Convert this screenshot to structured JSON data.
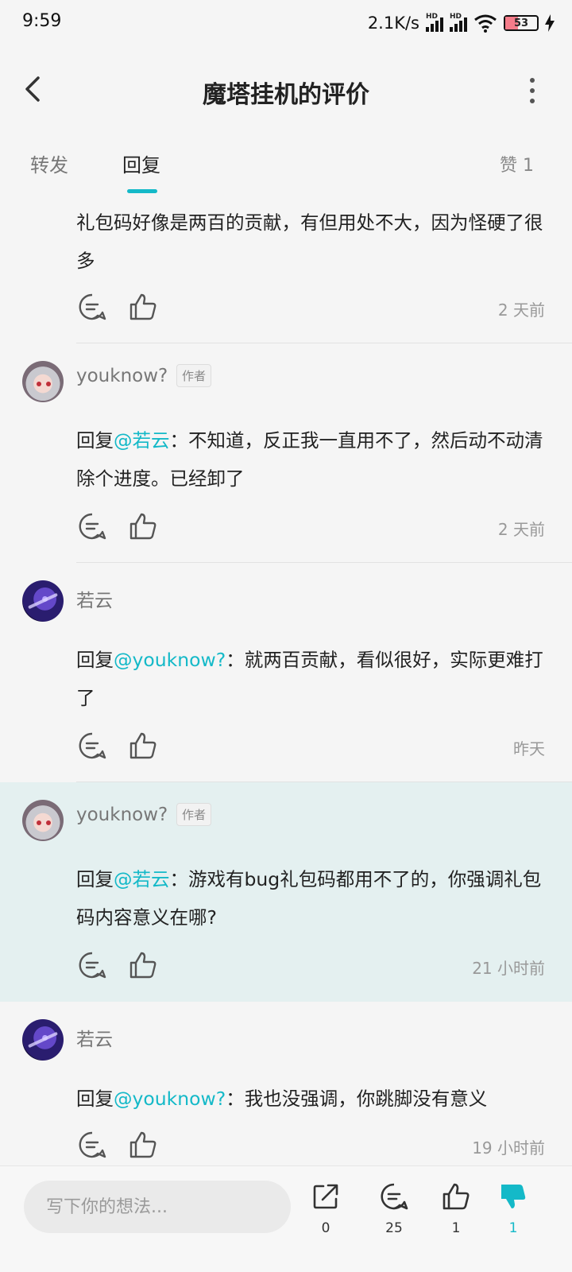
{
  "status": {
    "time": "9:59",
    "speed": "2.1K/s",
    "hd_label": "HD",
    "battery": "53"
  },
  "header": {
    "title": "魔塔挂机的评价"
  },
  "tabs": {
    "forward": "转发",
    "reply": "回复",
    "like": "赞 1"
  },
  "colors": {
    "accent": "#14b9c8",
    "highlight_bg": "#e4f0f0"
  },
  "comments": [
    {
      "text": "礼包码好像是两百的贡献，有但用处不大，因为怪硬了很多",
      "time": "2 天前"
    },
    {
      "user": "youknow?",
      "badge": "作者",
      "reply_prefix": "回复",
      "mention": "@若云",
      "text": "：不知道，反正我一直用不了，然后动不动清除个进度。已经卸了",
      "time": "2 天前"
    },
    {
      "user": "若云",
      "reply_prefix": "回复",
      "mention": "@youknow?",
      "text": "：就两百贡献，看似很好，实际更难打了",
      "time": "昨天"
    },
    {
      "user": "youknow?",
      "badge": "作者",
      "reply_prefix": "回复",
      "mention": "@若云",
      "text": "：游戏有bug礼包码都用不了的，你强调礼包码内容意义在哪?",
      "time": "21 小时前"
    },
    {
      "user": "若云",
      "reply_prefix": "回复",
      "mention": "@youknow?",
      "text": "：我也没强调，你跳脚没有意义",
      "time": "19 小时前"
    }
  ],
  "bottom": {
    "placeholder": "写下你的想法...",
    "share_count": "0",
    "comment_count": "25",
    "like_count": "1",
    "dislike_count": "1"
  }
}
